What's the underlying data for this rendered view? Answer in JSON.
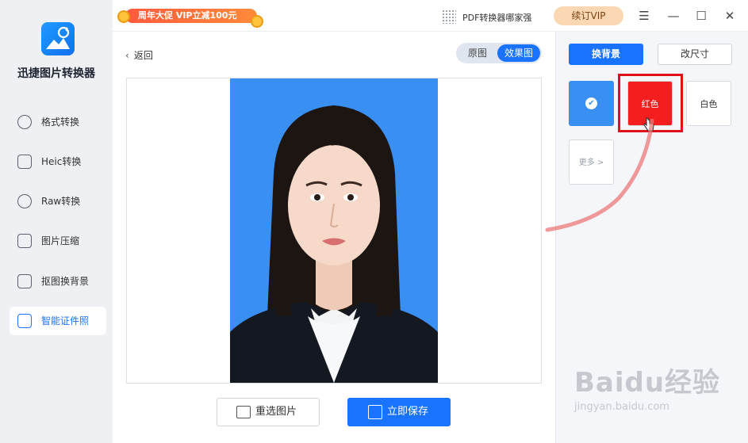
{
  "titlebar": {
    "promo": "周年大促 VIP立减100元",
    "pdf_ad": "PDF转换器哪家强",
    "vip_button": "续订VIP",
    "menu_icon": "hamburger-menu-icon",
    "minimize_icon": "minimize-icon",
    "maximize_icon": "maximize-icon",
    "close_icon": "close-icon"
  },
  "sidebar": {
    "app_name": "迅捷图片转换器",
    "items": [
      {
        "label": "格式转换",
        "icon": "swap-icon"
      },
      {
        "label": "Heic转换",
        "icon": "heic-file-icon"
      },
      {
        "label": "Raw转换",
        "icon": "raw-icon"
      },
      {
        "label": "图片压缩",
        "icon": "image-icon"
      },
      {
        "label": "抠图换背景",
        "icon": "cutout-icon"
      },
      {
        "label": "智能证件照",
        "icon": "id-card-icon",
        "active": true
      }
    ]
  },
  "main": {
    "back_label": "返回",
    "view_toggle": {
      "original": "原图",
      "result": "效果图",
      "selected": "效果图"
    },
    "reselect_button": "重选图片",
    "save_button": "立即保存"
  },
  "panel": {
    "tabs": {
      "background": "换背景",
      "size": "改尺寸",
      "active": "换背景"
    },
    "swatches": [
      {
        "label": "",
        "color": "#3a8ff2",
        "selected": true
      },
      {
        "label": "红色",
        "color": "#f51e1e"
      },
      {
        "label": "白色",
        "color": "#ffffff"
      },
      {
        "label": "更多 >",
        "color": "#ffffff"
      }
    ]
  },
  "watermark": {
    "brand": "Baidu经验",
    "url": "jingyan.baidu.com"
  },
  "colors": {
    "accent": "#1a73ff",
    "photo_bg": "#3a8ff2",
    "red": "#f51e1e"
  }
}
